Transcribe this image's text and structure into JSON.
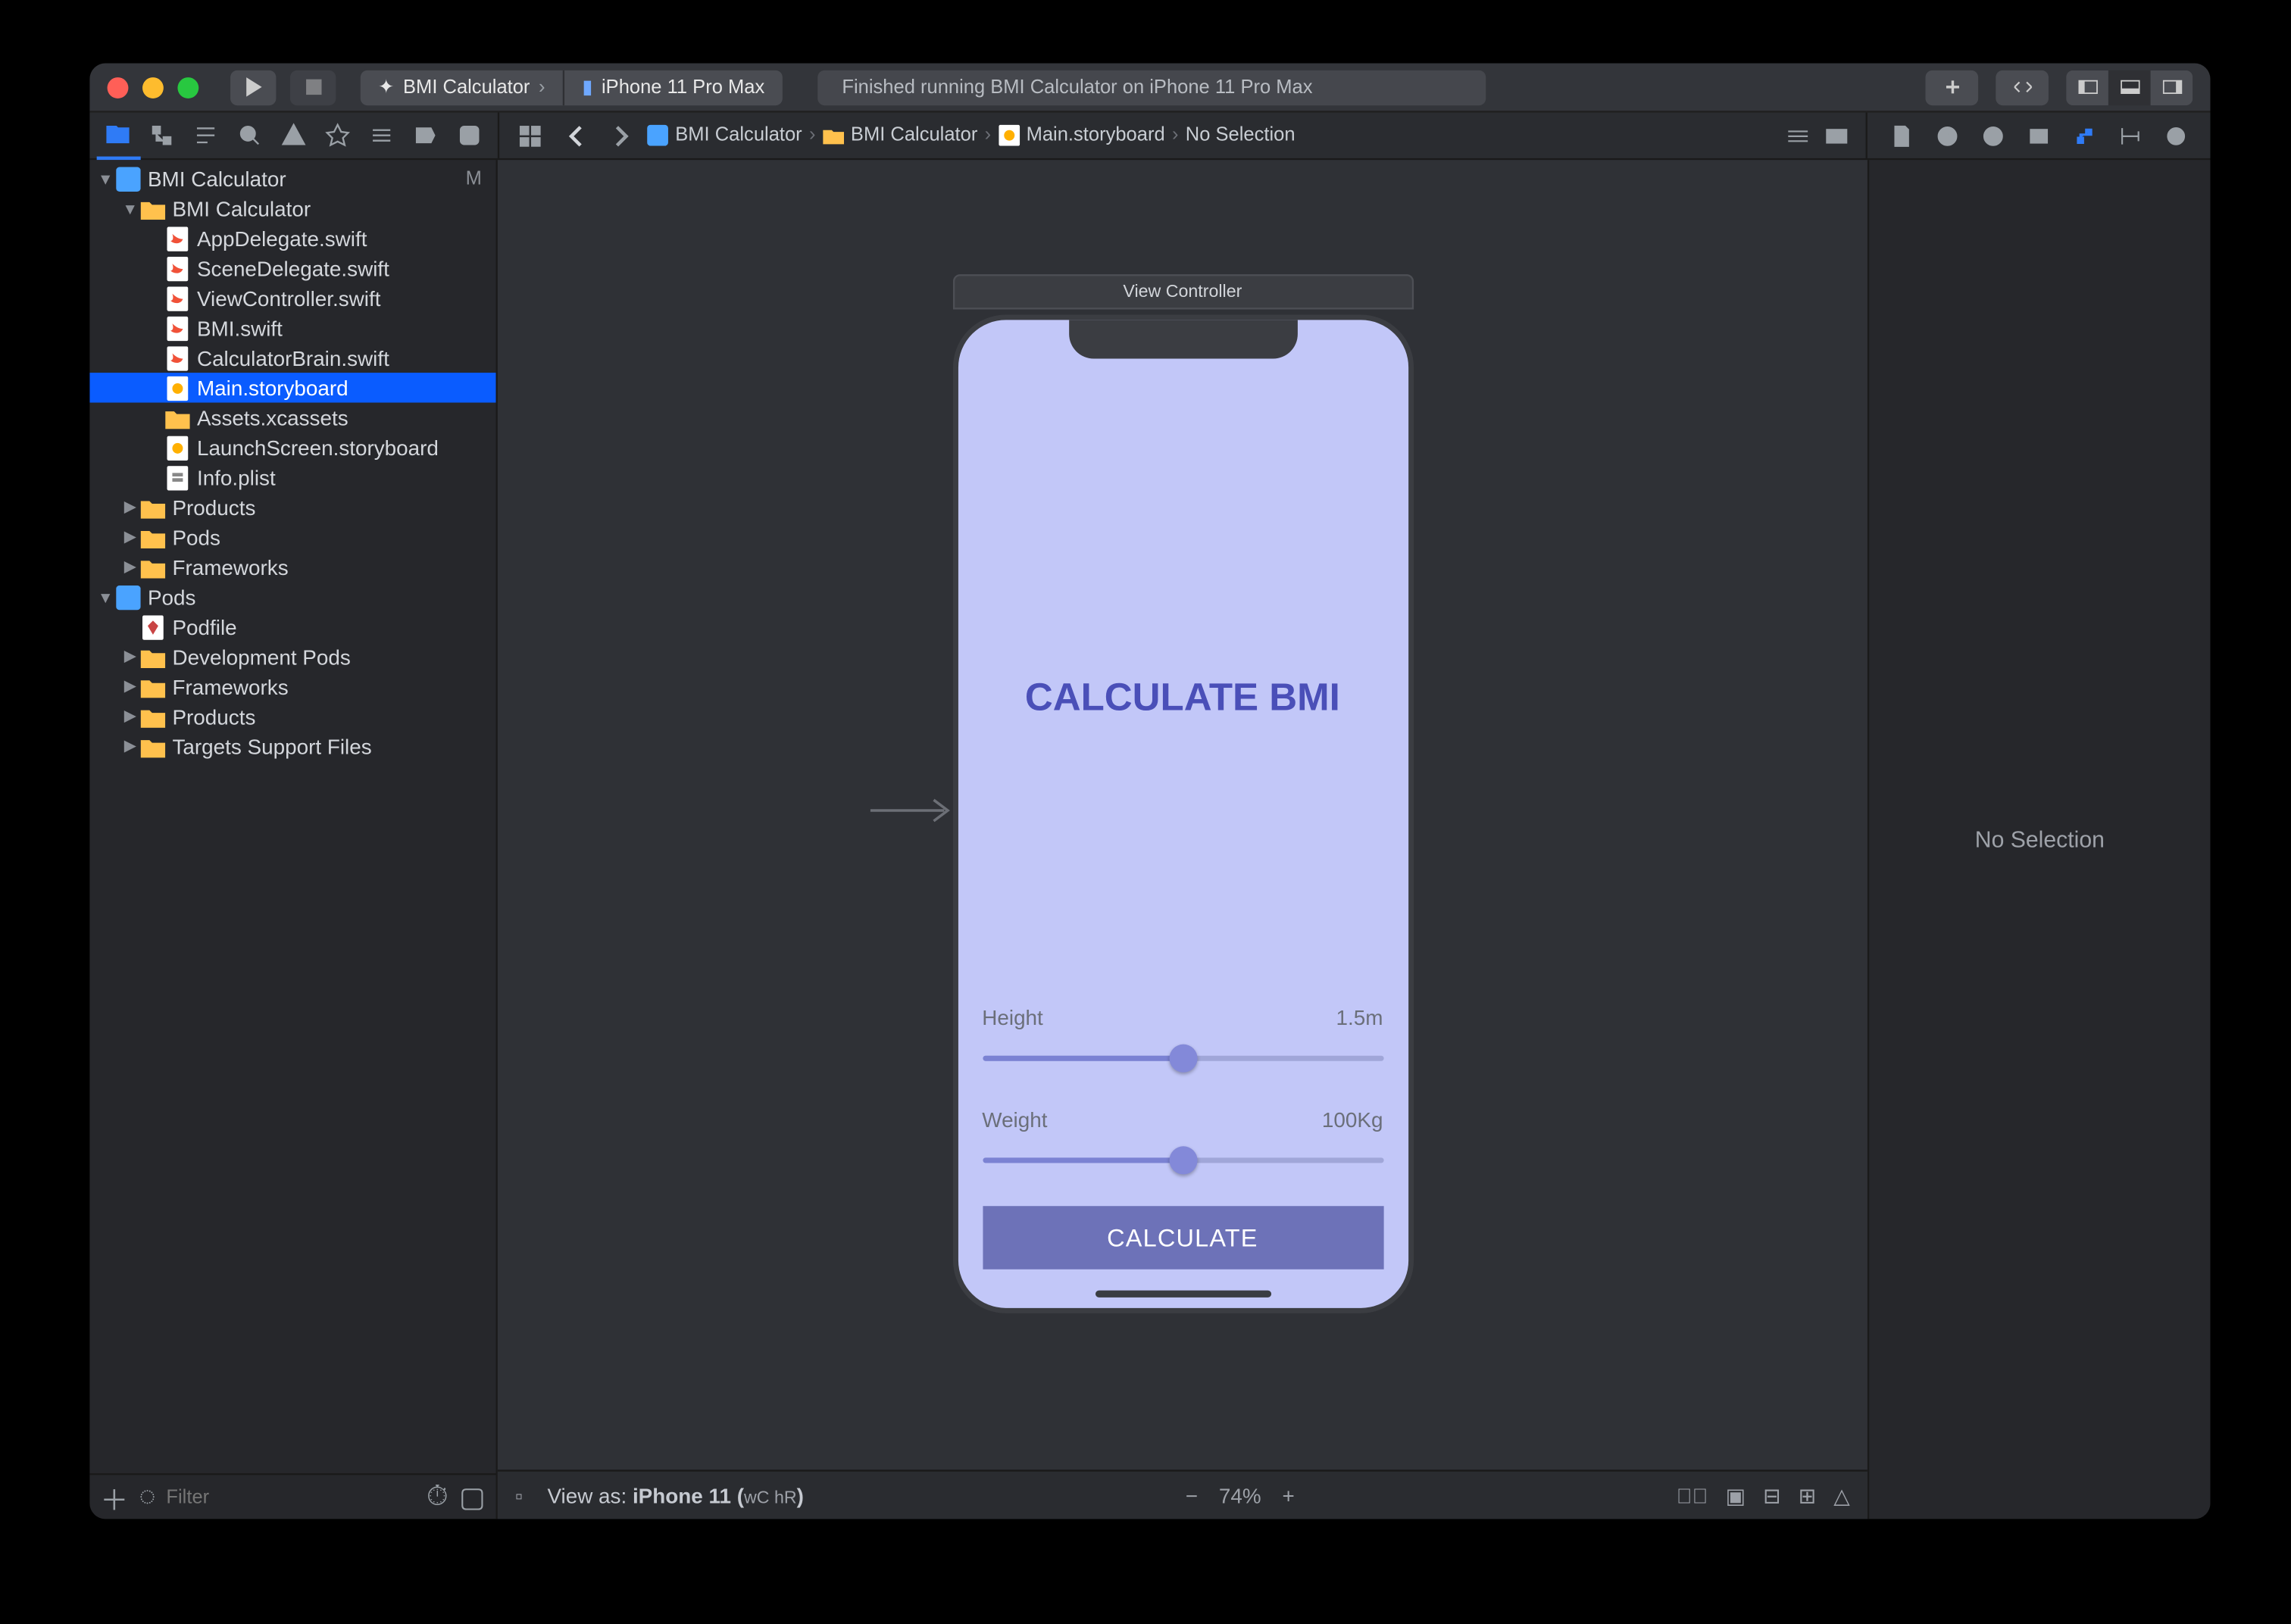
{
  "titlebar": {
    "scheme_app": "BMI Calculator",
    "scheme_device": "iPhone 11 Pro Max",
    "status": "Finished running BMI Calculator on iPhone 11 Pro Max"
  },
  "breadcrumb": {
    "items": [
      "BMI Calculator",
      "BMI Calculator",
      "Main.storyboard",
      "No Selection"
    ]
  },
  "navigator": {
    "root": {
      "label": "BMI Calculator",
      "badge": "M"
    },
    "group1_label": "BMI Calculator",
    "files": {
      "appdelegate": "AppDelegate.swift",
      "scenedelegate": "SceneDelegate.swift",
      "viewcontroller": "ViewController.swift",
      "bmi": "BMI.swift",
      "calcbrain": "CalculatorBrain.swift",
      "mainsb": "Main.storyboard",
      "assets": "Assets.xcassets",
      "launchsb": "LaunchScreen.storyboard",
      "infoplist": "Info.plist"
    },
    "folders1": {
      "products": "Products",
      "pods": "Pods",
      "frameworks": "Frameworks"
    },
    "pods_root": "Pods",
    "podfile": "Podfile",
    "folders2": {
      "devpods": "Development Pods",
      "frameworks": "Frameworks",
      "products": "Products",
      "targets": "Targets Support Files"
    },
    "filter_placeholder": "Filter"
  },
  "scene": {
    "controller_label": "View Controller",
    "title": "CALCULATE BMI",
    "height_label": "Height",
    "height_value": "1.5m",
    "weight_label": "Weight",
    "weight_value": "100Kg",
    "button": "CALCULATE"
  },
  "bottombar": {
    "view_as_prefix": "View as: ",
    "view_as_device": "iPhone 11 (",
    "view_as_wc": "wC",
    "view_as_hr": " hR",
    "view_as_suffix": ")",
    "zoom": "74%"
  },
  "inspector": {
    "empty": "No Selection"
  }
}
